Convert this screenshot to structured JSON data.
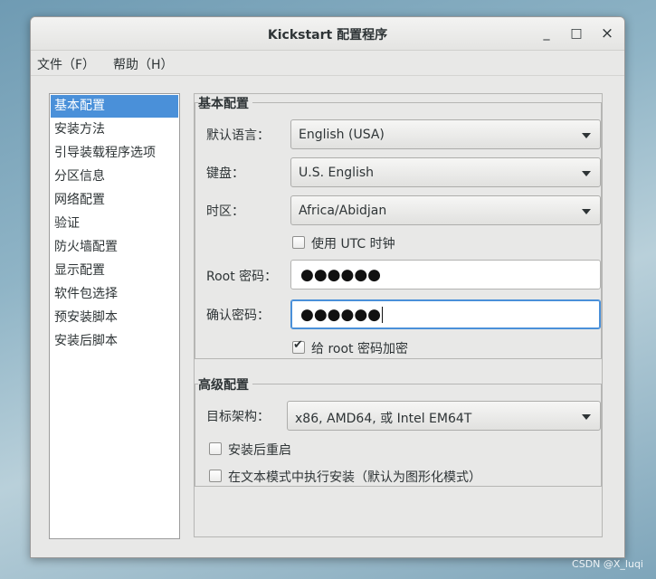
{
  "window": {
    "title": "Kickstart 配置程序",
    "minimize": "_",
    "maximize": "□",
    "close": "×"
  },
  "menu": [
    "文件（F）",
    "帮助（H）"
  ],
  "sidebar": {
    "items": [
      "基本配置",
      "安装方法",
      "引导装载程序选项",
      "分区信息",
      "网络配置",
      "验证",
      "防火墙配置",
      "显示配置",
      "软件包选择",
      "预安装脚本",
      "安装后脚本"
    ],
    "selected_index": 0
  },
  "basic": {
    "title": "基本配置",
    "language_label": "默认语言：",
    "language_value": "English (USA)",
    "keyboard_label": "键盘：",
    "keyboard_value": "U.S. English",
    "timezone_label": "时区：",
    "timezone_value": "Africa/Abidjan",
    "utc_label": "使用  UTC 时钟",
    "utc_checked": false,
    "root_pw_label": "Root 密码：",
    "root_pw_value": "●●●●●●",
    "confirm_pw_label": "确认密码：",
    "confirm_pw_value": "●●●●●●",
    "encrypt_label": "给  root 密码加密",
    "encrypt_checked": true
  },
  "advanced": {
    "title": "高级配置",
    "arch_label": "目标架构：",
    "arch_value": "x86, AMD64, 或  Intel EM64T",
    "reboot_label": "安装后重启",
    "reboot_checked": false,
    "textmode_label": "在文本模式中执行安装（默认为图形化模式）",
    "textmode_checked": false
  },
  "watermark": "CSDN @X_luqi",
  "colors": {
    "selection": "#4a90d9",
    "window_bg": "#e8e8e7"
  }
}
